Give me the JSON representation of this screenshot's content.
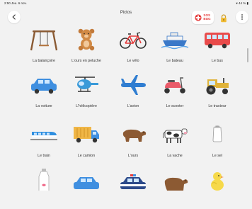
{
  "status_bar": {
    "time_date": "2:50 Jeu. 6 nov.",
    "battery": "44 %"
  },
  "header": {
    "title": "Pictos",
    "sos_label_line1": "SOS",
    "sos_label_line2": "BUG"
  },
  "colors": {
    "accent": "#e53939",
    "background": "#f2f2f2"
  },
  "icons": {
    "back": "chevron-left-icon",
    "sos": "red-cross-icon",
    "lock": "padlock-icon",
    "more": "vertical-dots-icon"
  },
  "pictos": [
    {
      "label": "La balançoire",
      "icon": "swing-icon"
    },
    {
      "label": "L'ours en peluche",
      "icon": "teddy-bear-icon"
    },
    {
      "label": "Le vélo",
      "icon": "bicycle-icon"
    },
    {
      "label": "Le bateau",
      "icon": "ship-icon"
    },
    {
      "label": "Le bus",
      "icon": "bus-icon"
    },
    {
      "label": "La voiture",
      "icon": "car-icon"
    },
    {
      "label": "L'hélicoptère",
      "icon": "helicopter-icon"
    },
    {
      "label": "L'avion",
      "icon": "airplane-icon"
    },
    {
      "label": "Le scooter",
      "icon": "scooter-icon"
    },
    {
      "label": "Le tracteur",
      "icon": "tractor-icon"
    },
    {
      "label": "Le train",
      "icon": "train-icon"
    },
    {
      "label": "Le camion",
      "icon": "truck-icon"
    },
    {
      "label": "L'ours",
      "icon": "bear-icon"
    },
    {
      "label": "La vache",
      "icon": "cow-icon"
    },
    {
      "label": "Le sel",
      "icon": "salt-shaker-icon"
    },
    {
      "label": "",
      "icon": "milk-bottle-icon"
    },
    {
      "label": "",
      "icon": "car-icon"
    },
    {
      "label": "",
      "icon": "police-car-icon"
    },
    {
      "label": "",
      "icon": "bear-icon"
    },
    {
      "label": "",
      "icon": "chick-icon"
    }
  ]
}
